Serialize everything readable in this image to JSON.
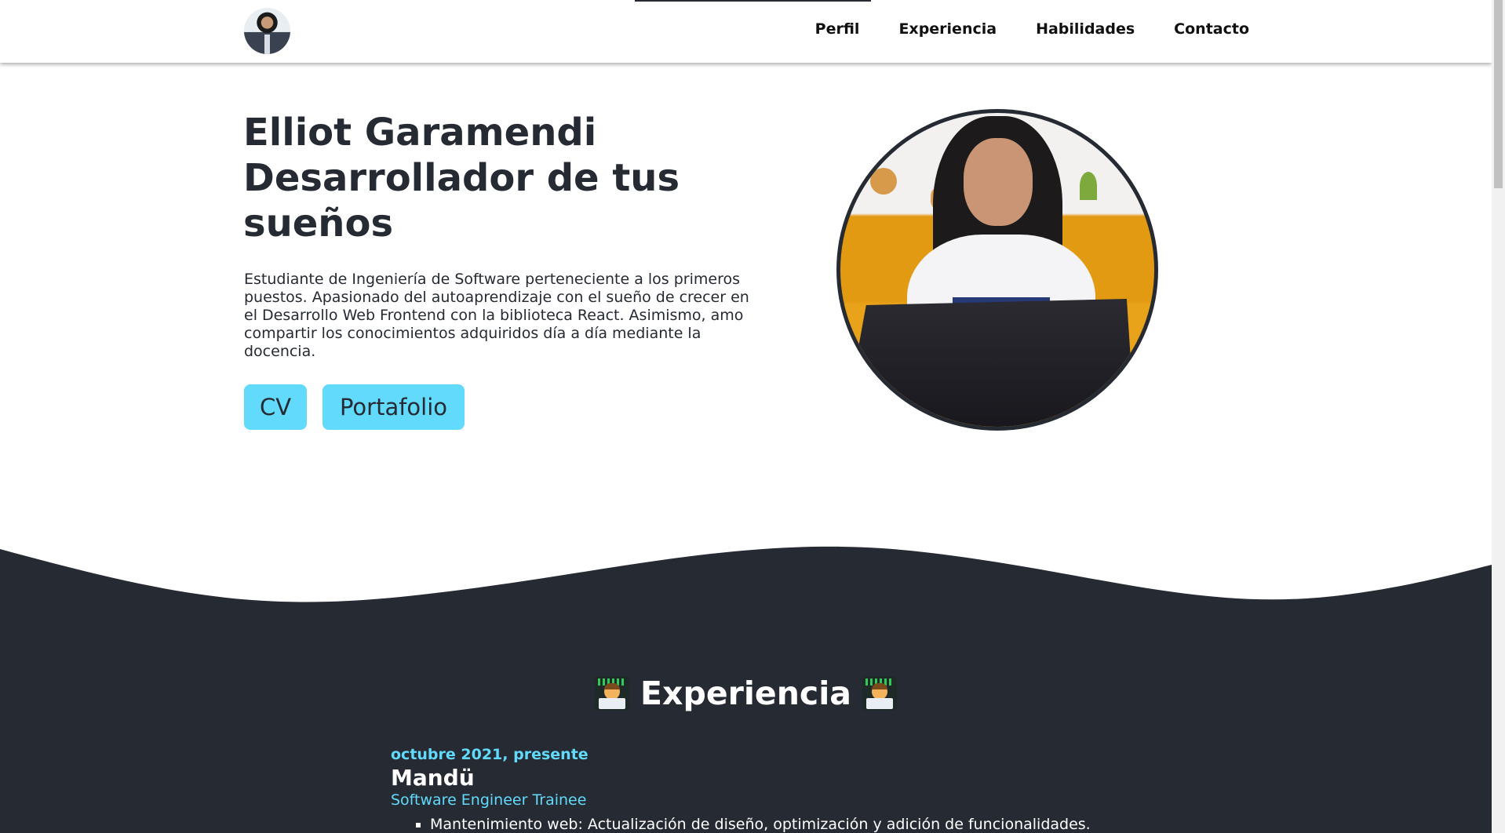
{
  "nav": {
    "links": [
      "Perfil",
      "Experiencia",
      "Habilidades",
      "Contacto"
    ]
  },
  "hero": {
    "title_lines": [
      "Elliot Garamendi",
      "Desarrollador de tus",
      "sueños"
    ],
    "description": "Estudiante de Ingeniería de Software perteneciente a los primeros puestos. Apasionado del autoaprendizaje con el sueño de crecer en el Desarrollo Web Frontend con la biblioteca React. Asimismo, amo compartir los conocimientos adquiridos día a día mediante la docencia.",
    "buttons": {
      "cv": "CV",
      "portfolio": "Portafolio"
    }
  },
  "experience": {
    "heading": "Experiencia",
    "heading_icon": "technologist-emoji",
    "items": [
      {
        "date": "octubre 2021, presente",
        "company": "Mandü",
        "role": "Software Engineer Trainee",
        "bullets": [
          "Mantenimiento web: Actualización de diseño, optimización y adición de funcionalidades."
        ]
      }
    ]
  },
  "colors": {
    "dark": "#262a33",
    "accent": "#61dafb",
    "white": "#ffffff"
  }
}
